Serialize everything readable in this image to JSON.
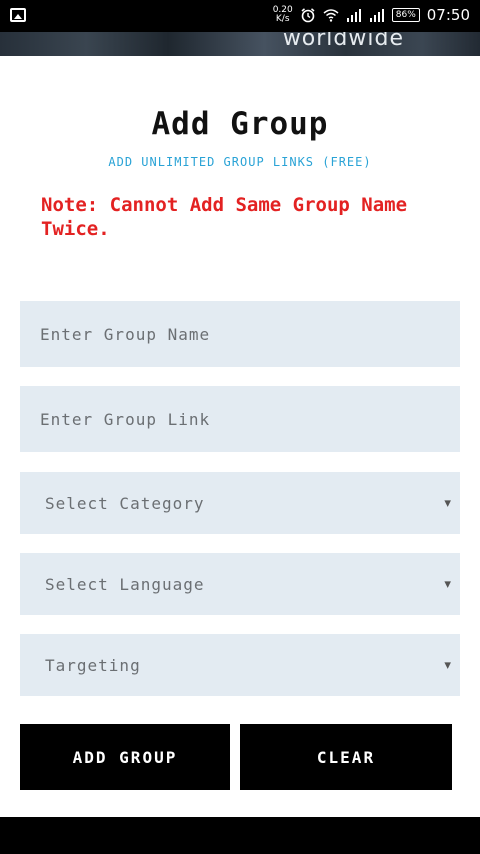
{
  "status_bar": {
    "net_speed_value": "0.20",
    "net_speed_unit": "K/s",
    "battery": "86%",
    "time": "07:50",
    "icons": [
      "image-icon",
      "alarm-icon",
      "wifi-icon",
      "signal-icon",
      "signal-icon",
      "battery-icon"
    ]
  },
  "banner": {
    "text": "worldwide"
  },
  "page": {
    "title": "Add Group",
    "subtitle": "ADD UNLIMITED GROUP LINKS (FREE)",
    "note": "Note: Cannot Add Same Group Name Twice."
  },
  "form": {
    "group_name_placeholder": "Enter Group Name",
    "group_link_placeholder": "Enter Group Link",
    "category_selected": "Select Category",
    "language_selected": "Select Language",
    "targeting_selected": "Targeting",
    "caret": "▼"
  },
  "buttons": {
    "add_group": "ADD GROUP",
    "clear": "CLEAR"
  },
  "colors": {
    "note_red": "#e32222",
    "subtitle_blue": "#2aa3d6",
    "field_bg": "#e3ebf2",
    "button_bg": "#000000"
  }
}
